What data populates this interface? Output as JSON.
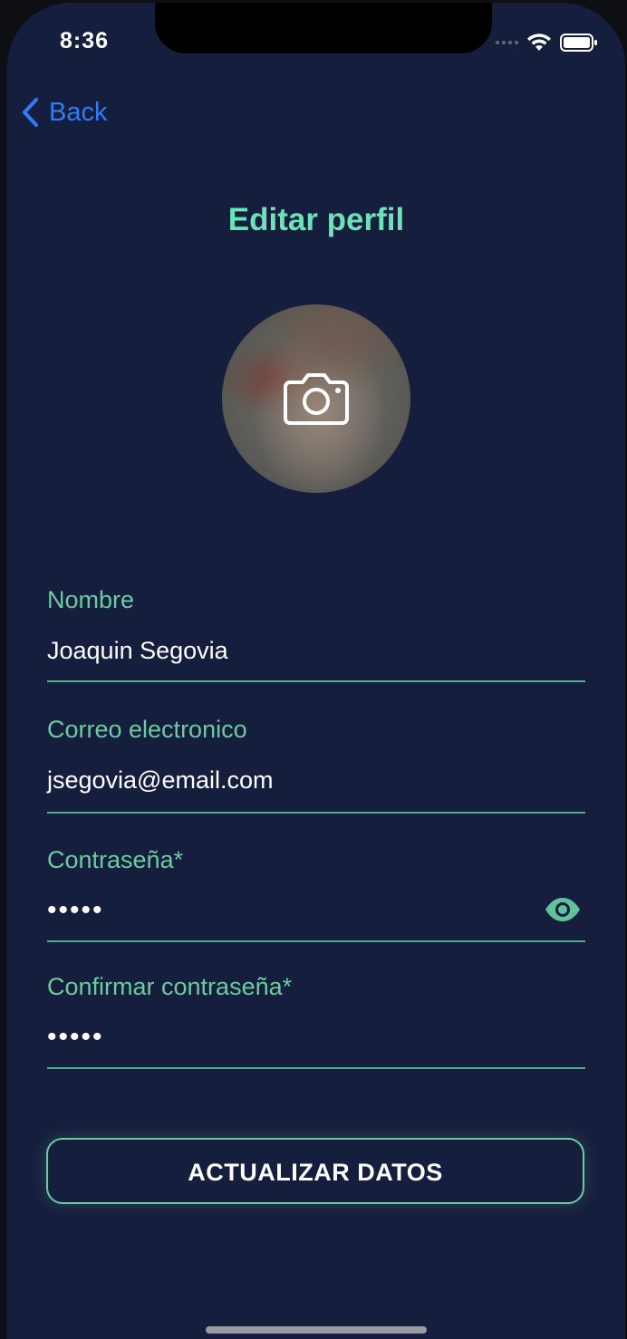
{
  "status_bar": {
    "time": "8:36"
  },
  "nav": {
    "back_label": "Back"
  },
  "page": {
    "title": "Editar perfil"
  },
  "avatar": {
    "camera_icon": "camera-icon"
  },
  "form": {
    "name": {
      "label": "Nombre",
      "value": "Joaquin Segovia"
    },
    "email": {
      "label": "Correo electronico",
      "value": "jsegovia@email.com"
    },
    "password": {
      "label": "Contraseña*",
      "value": "•••••",
      "toggle_icon": "eye-icon"
    },
    "confirm_password": {
      "label": "Confirmar contraseña*",
      "value": "•••••"
    }
  },
  "actions": {
    "update_label": "ACTUALIZAR DATOS"
  },
  "colors": {
    "background": "#161e3e",
    "accent": "#6ccaa0",
    "title": "#6ce3b6",
    "link": "#2f7df6"
  }
}
